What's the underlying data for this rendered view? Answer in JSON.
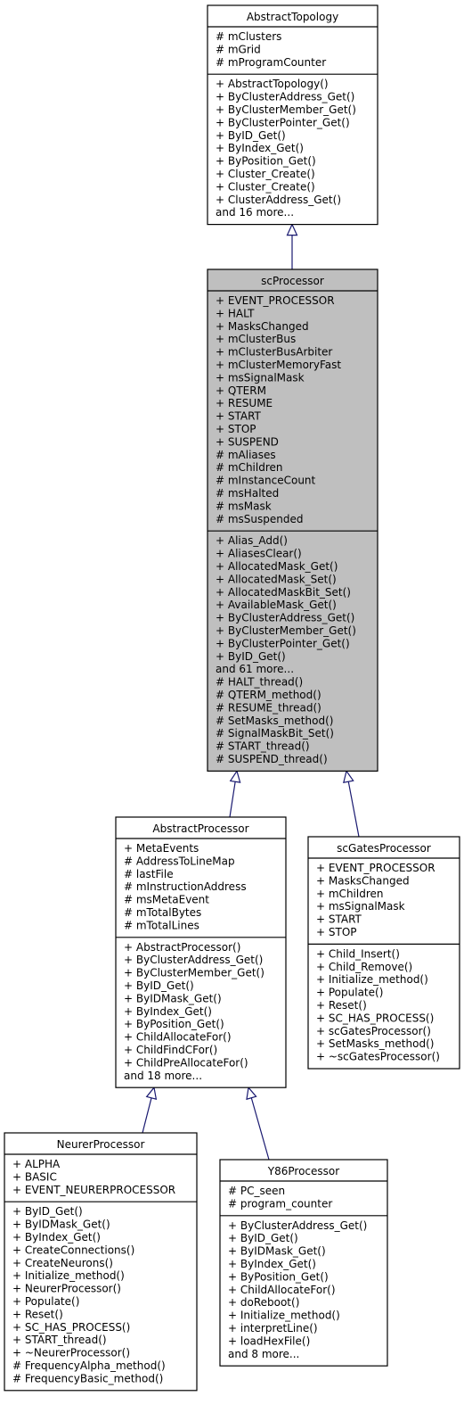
{
  "diagram": {
    "type": "class-inheritance",
    "classes": [
      {
        "id": "AbstractTopology",
        "name": "AbstractTopology",
        "highlighted": false,
        "attributes": [
          "# mClusters",
          "# mGrid",
          "# mProgramCounter"
        ],
        "methods": [
          "+ AbstractTopology()",
          "+ ByClusterAddress_Get()",
          "+ ByClusterMember_Get()",
          "+ ByClusterPointer_Get()",
          "+ ByID_Get()",
          "+ ByIndex_Get()",
          "+ ByPosition_Get()",
          "+ Cluster_Create()",
          "+ Cluster_Create()",
          "+ ClusterAddress_Get()",
          "and 16 more..."
        ]
      },
      {
        "id": "scProcessor",
        "name": "scProcessor",
        "highlighted": true,
        "attributes": [
          "+ EVENT_PROCESSOR",
          "+ HALT",
          "+ MasksChanged",
          "+ mClusterBus",
          "+ mClusterBusArbiter",
          "+ mClusterMemoryFast",
          "+ msSignalMask",
          "+ QTERM",
          "+ RESUME",
          "+ START",
          "+ STOP",
          "+ SUSPEND",
          "# mAliases",
          "# mChildren",
          "# mInstanceCount",
          "# msHalted",
          "# msMask",
          "# msSuspended"
        ],
        "methods": [
          "+ Alias_Add()",
          "+ AliasesClear()",
          "+ AllocatedMask_Get()",
          "+ AllocatedMask_Set()",
          "+ AllocatedMaskBit_Set()",
          "+ AvailableMask_Get()",
          "+ ByClusterAddress_Get()",
          "+ ByClusterMember_Get()",
          "+ ByClusterPointer_Get()",
          "+ ByID_Get()",
          "and 61 more...",
          "# HALT_thread()",
          "# QTERM_method()",
          "# RESUME_thread()",
          "# SetMasks_method()",
          "# SignalMaskBit_Set()",
          "# START_thread()",
          "# SUSPEND_thread()"
        ]
      },
      {
        "id": "AbstractProcessor",
        "name": "AbstractProcessor",
        "highlighted": false,
        "attributes": [
          "+ MetaEvents",
          "# AddressToLineMap",
          "# lastFile",
          "# mInstructionAddress",
          "# msMetaEvent",
          "# mTotalBytes",
          "# mTotalLines"
        ],
        "methods": [
          "+ AbstractProcessor()",
          "+ ByClusterAddress_Get()",
          "+ ByClusterMember_Get()",
          "+ ByID_Get()",
          "+ ByIDMask_Get()",
          "+ ByIndex_Get()",
          "+ ByPosition_Get()",
          "+ ChildAllocateFor()",
          "+ ChildFindCFor()",
          "+ ChildPreAllocateFor()",
          "and 18 more..."
        ]
      },
      {
        "id": "scGatesProcessor",
        "name": "scGatesProcessor",
        "highlighted": false,
        "attributes": [
          "+ EVENT_PROCESSOR",
          "+ MasksChanged",
          "+ mChildren",
          "+ msSignalMask",
          "+ START",
          "+ STOP"
        ],
        "methods": [
          "+ Child_Insert()",
          "+ Child_Remove()",
          "+ Initialize_method()",
          "+ Populate()",
          "+ Reset()",
          "+ SC_HAS_PROCESS()",
          "+ scGatesProcessor()",
          "+ SetMasks_method()",
          "+ ~scGatesProcessor()"
        ]
      },
      {
        "id": "NeurerProcessor",
        "name": "NeurerProcessor",
        "highlighted": false,
        "attributes": [
          "+ ALPHA",
          "+ BASIC",
          "+ EVENT_NEURERPROCESSOR"
        ],
        "methods": [
          "+ ByID_Get()",
          "+ ByIDMask_Get()",
          "+ ByIndex_Get()",
          "+ CreateConnections()",
          "+ CreateNeurons()",
          "+ Initialize_method()",
          "+ NeurerProcessor()",
          "+ Populate()",
          "+ Reset()",
          "+ SC_HAS_PROCESS()",
          "+ START_thread()",
          "+ ~NeurerProcessor()",
          "# FrequencyAlpha_method()",
          "# FrequencyBasic_method()"
        ]
      },
      {
        "id": "Y86Processor",
        "name": "Y86Processor",
        "highlighted": false,
        "attributes": [
          "# PC_seen",
          "# program_counter"
        ],
        "methods": [
          "+ ByClusterAddress_Get()",
          "+ ByID_Get()",
          "+ ByIDMask_Get()",
          "+ ByIndex_Get()",
          "+ ByPosition_Get()",
          "+ ChildAllocateFor()",
          "+ doReboot()",
          "+ Initialize_method()",
          "+ interpretLine()",
          "+ loadHexFile()",
          "and 8 more..."
        ]
      }
    ],
    "inheritance": [
      {
        "child": "scProcessor",
        "parent": "AbstractTopology"
      },
      {
        "child": "AbstractProcessor",
        "parent": "scProcessor"
      },
      {
        "child": "scGatesProcessor",
        "parent": "scProcessor"
      },
      {
        "child": "NeurerProcessor",
        "parent": "AbstractProcessor"
      },
      {
        "child": "Y86Processor",
        "parent": "AbstractProcessor"
      }
    ],
    "colors": {
      "highlight_fill": "#bfbfbf",
      "edge": "#191970",
      "border": "#000000"
    }
  }
}
